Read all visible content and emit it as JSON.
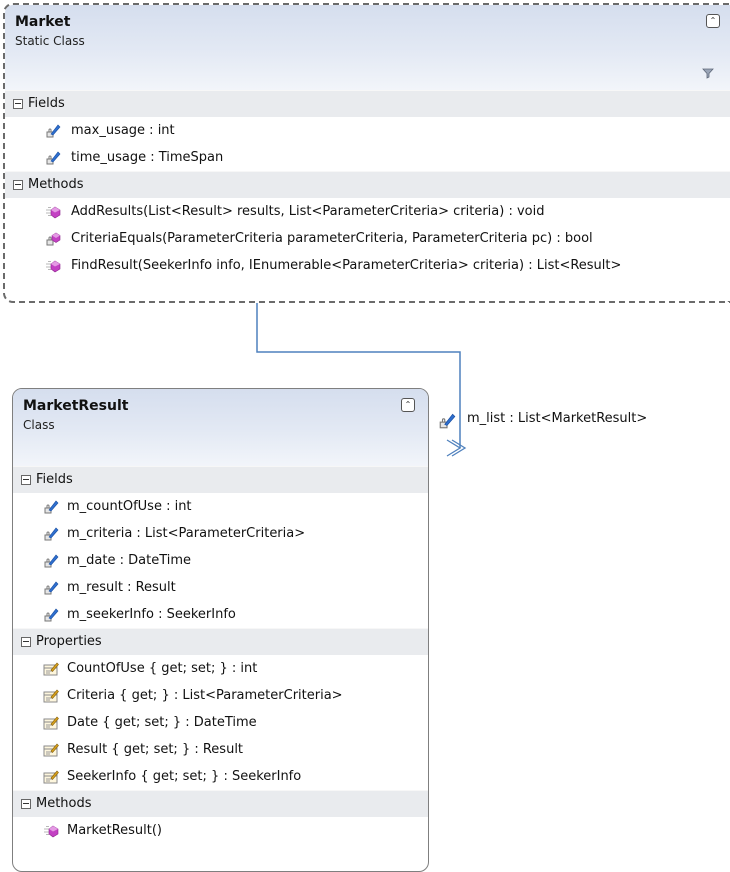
{
  "colors": {
    "header_gradient_top": "#d5deee",
    "section_bg": "#e9ebee",
    "connector": "#4f81bd",
    "method_icon": "#c341c3",
    "field_icon": "#2f6fcf"
  },
  "market": {
    "title": "Market",
    "kind": "Static Class",
    "fields_label": "Fields",
    "fields": [
      {
        "icon": "field-icon",
        "text": "max_usage : int"
      },
      {
        "icon": "field-icon",
        "text": "time_usage : TimeSpan"
      }
    ],
    "methods_label": "Methods",
    "methods": [
      {
        "icon": "public-method-icon",
        "text": "AddResults(List<Result> results, List<ParameterCriteria> criteria) : void"
      },
      {
        "icon": "private-method-icon",
        "text": "CriteriaEquals(ParameterCriteria parameterCriteria, ParameterCriteria pc) : bool"
      },
      {
        "icon": "public-method-icon",
        "text": "FindResult(SeekerInfo info, IEnumerable<ParameterCriteria> criteria) : List<Result>"
      }
    ]
  },
  "association": {
    "icon": "field-icon",
    "label": "m_list : List<MarketResult>"
  },
  "market_result": {
    "title": "MarketResult",
    "kind": "Class",
    "fields_label": "Fields",
    "fields": [
      {
        "icon": "field-icon",
        "text": "m_countOfUse : int"
      },
      {
        "icon": "field-icon",
        "text": "m_criteria : List<ParameterCriteria>"
      },
      {
        "icon": "field-icon",
        "text": "m_date : DateTime"
      },
      {
        "icon": "field-icon",
        "text": "m_result : Result"
      },
      {
        "icon": "field-icon",
        "text": "m_seekerInfo : SeekerInfo"
      }
    ],
    "properties_label": "Properties",
    "properties": [
      {
        "icon": "property-icon",
        "text": "CountOfUse { get; set; } : int"
      },
      {
        "icon": "property-icon",
        "text": "Criteria { get; } : List<ParameterCriteria>"
      },
      {
        "icon": "property-icon",
        "text": "Date { get; set; } : DateTime"
      },
      {
        "icon": "property-icon",
        "text": "Result { get; set; } : Result"
      },
      {
        "icon": "property-icon",
        "text": "SeekerInfo { get; set; } : SeekerInfo"
      }
    ],
    "methods_label": "Methods",
    "methods": [
      {
        "icon": "public-method-icon",
        "text": "MarketResult()"
      }
    ]
  }
}
